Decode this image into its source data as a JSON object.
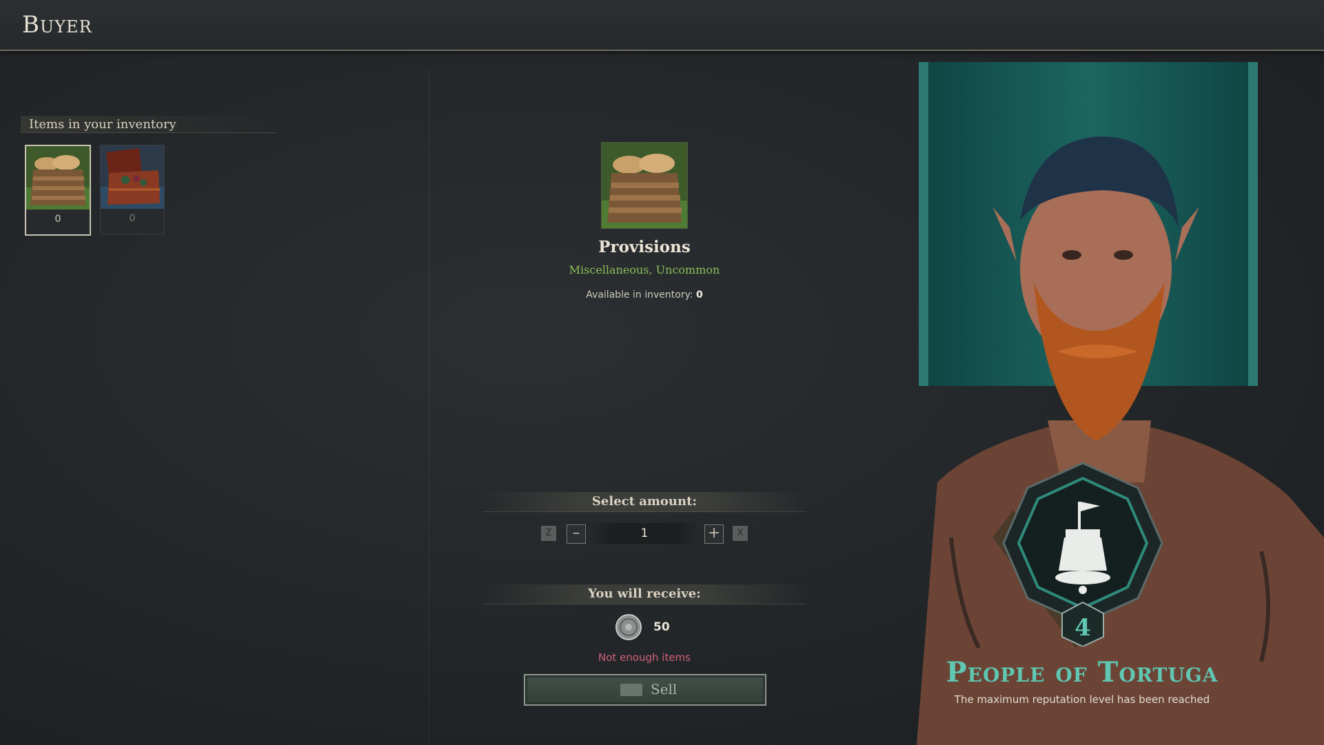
{
  "header": {
    "title": "Buyer"
  },
  "inventory": {
    "title": "Items in your inventory",
    "items": [
      {
        "name": "provisions-crate",
        "count": "0",
        "selected": true
      },
      {
        "name": "treasure-chest",
        "count": "0",
        "selected": false
      }
    ]
  },
  "item": {
    "name": "Provisions",
    "category": "Miscellaneous, Uncommon",
    "available_label": "Available in inventory:",
    "available_value": "0"
  },
  "amount": {
    "title": "Select amount:",
    "value": "1",
    "decrease_key": "Z",
    "increase_key": "X"
  },
  "receive": {
    "title": "You will receive:",
    "value": "50",
    "warning": "Not enough items"
  },
  "sell": {
    "label": "Sell"
  },
  "faction": {
    "name": "People of Tortuga",
    "level": "4",
    "status": "The maximum reputation level has been reached"
  },
  "colors": {
    "accent_teal": "#5fc7b2",
    "warning_red": "#d0607a",
    "uncommon_green": "#8bbf5a"
  }
}
